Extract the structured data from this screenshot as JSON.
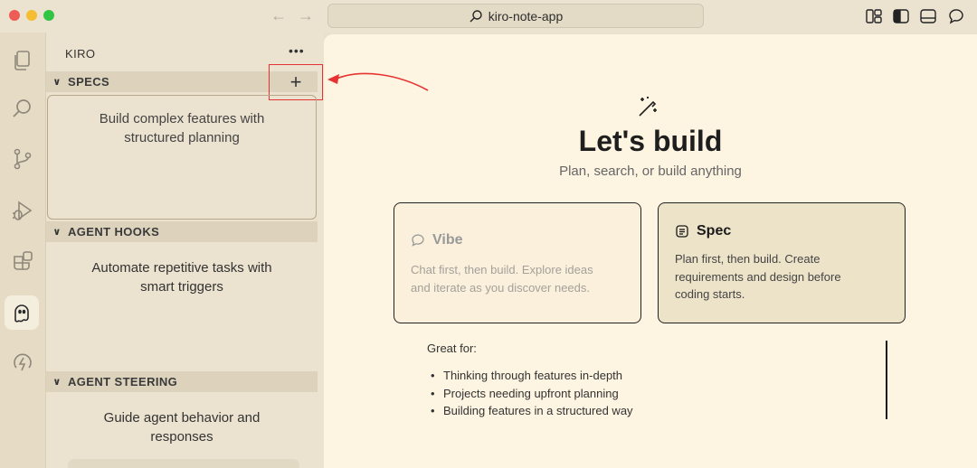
{
  "window": {
    "address": "kiro-note-app"
  },
  "titlebar": {
    "back_icon": "arrow-left-icon",
    "forward_icon": "arrow-right-icon",
    "back_glyph": "←",
    "forward_glyph": "→",
    "right_icons": [
      "layout-icon",
      "sidebar-left-icon",
      "panel-bottom-icon",
      "chat-icon"
    ]
  },
  "activity_bar": {
    "items": [
      "explorer-icon",
      "search-icon",
      "source-control-icon",
      "run-debug-icon",
      "extensions-icon",
      "kiro-ghost-icon",
      "power-icon"
    ],
    "active": "kiro-ghost-icon"
  },
  "sidebar": {
    "title": "KIRO",
    "more_label": "•••",
    "specs": {
      "header": "SPECS",
      "add_label": "+",
      "description_line1": "Build complex features with",
      "description_line2": "structured planning"
    },
    "hooks": {
      "header": "AGENT HOOKS",
      "description_line1": "Automate repetitive tasks with",
      "description_line2": "smart triggers"
    },
    "steering": {
      "header": "AGENT STEERING",
      "description_line1": "Guide agent behavior and",
      "description_line2": "responses"
    }
  },
  "main": {
    "title": "Let's build",
    "subtitle": "Plan, search, or build anything",
    "cards": {
      "vibe": {
        "title": "Vibe",
        "line1": "Chat first, then build. Explore ideas",
        "line2": "and iterate as you discover needs."
      },
      "spec": {
        "title": "Spec",
        "line1": "Plan first, then build. Create",
        "line2": "requirements and design before",
        "line3": "coding starts."
      }
    },
    "great_for": {
      "title": "Great for:",
      "items": [
        "Thinking through features in-depth",
        "Projects needing upfront planning",
        "Building features in a structured way"
      ]
    }
  },
  "colors": {
    "accent_red": "#e63232",
    "main_bg": "#fdf4e1",
    "sidebar_bg": "#ebe2cf"
  }
}
